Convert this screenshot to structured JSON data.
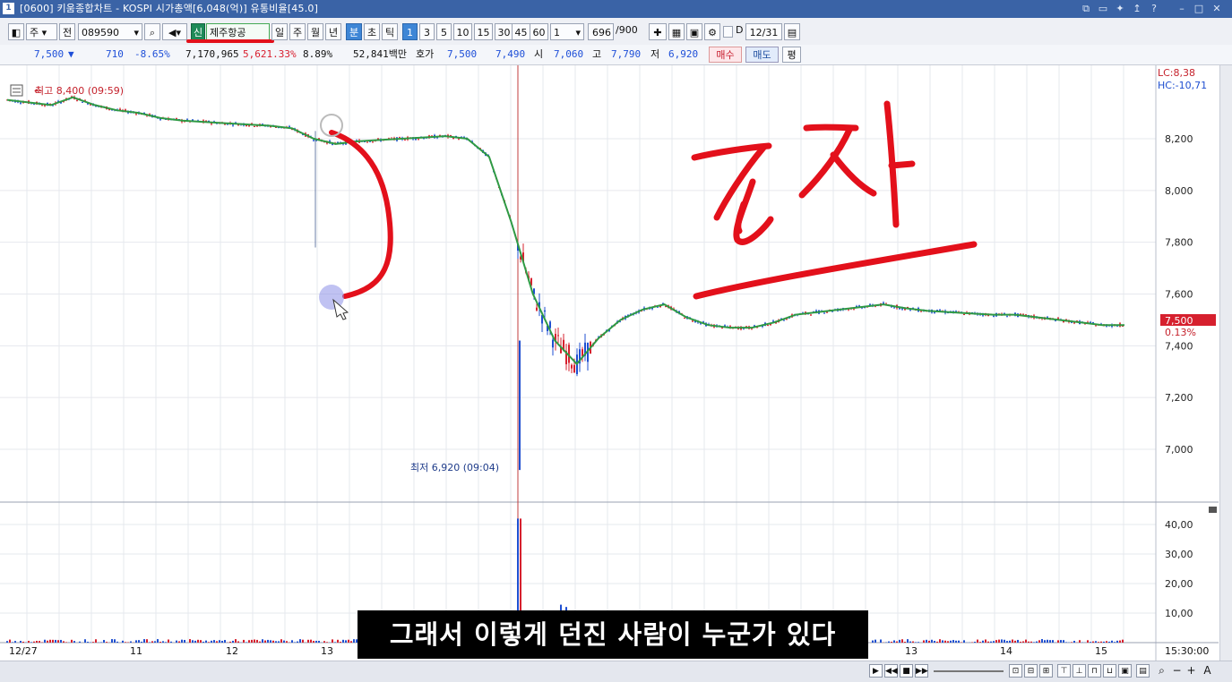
{
  "window": {
    "app_icon": "1",
    "title": "[0600] 키움종합차트 - KOSPI 시가총액[6,048(억)] 유통비율[45.0]",
    "buttons": [
      "window-arrange-icon",
      "window-tile-icon",
      "pin-icon",
      "arrow-up-icon",
      "help-icon",
      "minimize-icon",
      "maximize-icon",
      "close-icon"
    ]
  },
  "toolbar": {
    "period_select": "주",
    "scope_button": "전",
    "stock_code": "089590",
    "new_badge": "신",
    "stock_name": "제주항공",
    "period_tabs": [
      "일",
      "주",
      "월",
      "년",
      "분",
      "초",
      "틱"
    ],
    "minute_values": [
      "1",
      "3",
      "5",
      "10",
      "15",
      "30",
      "45",
      "60"
    ],
    "unit_value": "1",
    "count_current": "696",
    "count_total": "/900",
    "date_label": "D",
    "date_value": "12/31"
  },
  "quote": {
    "price": "7,500",
    "direction": "▼",
    "change": "710",
    "change_pct": "-8.65%",
    "volume": "7,170,965",
    "volume_ratio": "5,621.33%",
    "turnover": "8.89%",
    "trade_value": "52,841백만",
    "hoga_label": "호가",
    "ask": "7,500",
    "bid": "7,490",
    "open_label": "시",
    "open": "7,060",
    "high_label": "고",
    "high": "7,790",
    "low_label": "저",
    "low": "6,920",
    "buy_button": "매수",
    "sell_button": "매도",
    "eval_button": "평"
  },
  "chart": {
    "max_label": "최고 8,400 (09:59)",
    "min_label": "최저 6,920 (09:04)",
    "lc_label": "LC:8,38",
    "hc_label": "HC:-10,71",
    "current_price_tag": "7,500",
    "current_change_tag": "0.13%",
    "handwriting": "조작",
    "price_axis": [
      "8,200",
      "8,000",
      "7,800",
      "7,600",
      "7,400",
      "7,200",
      "7,000"
    ],
    "volume_axis": [
      "40,00",
      "30,00",
      "20,00",
      "10,00"
    ],
    "time_axis": [
      "12/27",
      "11",
      "12",
      "13",
      "13",
      "14",
      "15",
      "15:30:00"
    ]
  },
  "chart_data": {
    "type": "line",
    "title": "",
    "series": [
      {
        "values": [
          8350,
          8340,
          8330,
          8360,
          8330,
          8310,
          8300,
          8280,
          8270,
          8265,
          8260,
          8255,
          8250,
          8240,
          8200,
          8180,
          8190,
          8195,
          8200,
          8205,
          8210,
          8200,
          8130,
          7880,
          7600,
          7420,
          7330,
          7430,
          7500,
          7540,
          7560,
          7510,
          7480,
          7470,
          7470,
          7490,
          7520,
          7530,
          7540,
          7550,
          7560,
          7545,
          7535,
          7530,
          7525,
          7520,
          7520,
          7510,
          7500,
          7490,
          7480,
          7480
        ]
      }
    ],
    "price_range": [
      6920,
      8400
    ],
    "volume_range": [
      0,
      45
    ]
  },
  "subtitle": "그래서 이렇게 던진 사람이 누군가 있다"
}
